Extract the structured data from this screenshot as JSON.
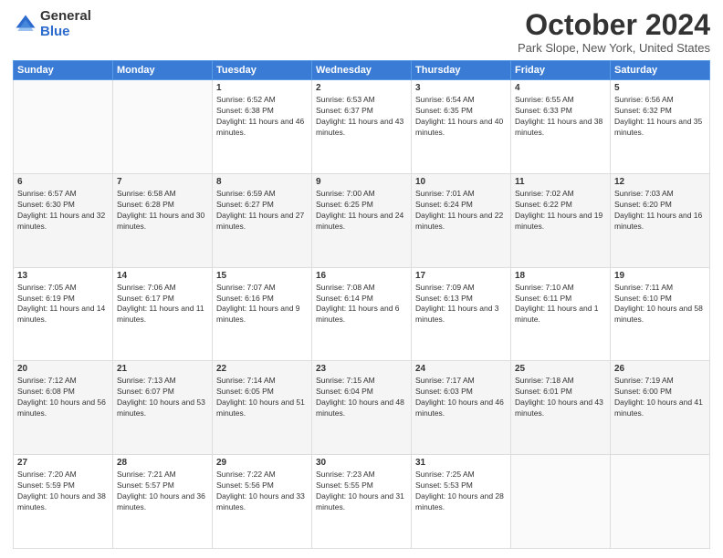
{
  "logo": {
    "general": "General",
    "blue": "Blue"
  },
  "title": {
    "month": "October 2024",
    "location": "Park Slope, New York, United States"
  },
  "days_header": [
    "Sunday",
    "Monday",
    "Tuesday",
    "Wednesday",
    "Thursday",
    "Friday",
    "Saturday"
  ],
  "weeks": [
    [
      {
        "day": "",
        "info": ""
      },
      {
        "day": "",
        "info": ""
      },
      {
        "day": "1",
        "info": "Sunrise: 6:52 AM\nSunset: 6:38 PM\nDaylight: 11 hours and 46 minutes."
      },
      {
        "day": "2",
        "info": "Sunrise: 6:53 AM\nSunset: 6:37 PM\nDaylight: 11 hours and 43 minutes."
      },
      {
        "day": "3",
        "info": "Sunrise: 6:54 AM\nSunset: 6:35 PM\nDaylight: 11 hours and 40 minutes."
      },
      {
        "day": "4",
        "info": "Sunrise: 6:55 AM\nSunset: 6:33 PM\nDaylight: 11 hours and 38 minutes."
      },
      {
        "day": "5",
        "info": "Sunrise: 6:56 AM\nSunset: 6:32 PM\nDaylight: 11 hours and 35 minutes."
      }
    ],
    [
      {
        "day": "6",
        "info": "Sunrise: 6:57 AM\nSunset: 6:30 PM\nDaylight: 11 hours and 32 minutes."
      },
      {
        "day": "7",
        "info": "Sunrise: 6:58 AM\nSunset: 6:28 PM\nDaylight: 11 hours and 30 minutes."
      },
      {
        "day": "8",
        "info": "Sunrise: 6:59 AM\nSunset: 6:27 PM\nDaylight: 11 hours and 27 minutes."
      },
      {
        "day": "9",
        "info": "Sunrise: 7:00 AM\nSunset: 6:25 PM\nDaylight: 11 hours and 24 minutes."
      },
      {
        "day": "10",
        "info": "Sunrise: 7:01 AM\nSunset: 6:24 PM\nDaylight: 11 hours and 22 minutes."
      },
      {
        "day": "11",
        "info": "Sunrise: 7:02 AM\nSunset: 6:22 PM\nDaylight: 11 hours and 19 minutes."
      },
      {
        "day": "12",
        "info": "Sunrise: 7:03 AM\nSunset: 6:20 PM\nDaylight: 11 hours and 16 minutes."
      }
    ],
    [
      {
        "day": "13",
        "info": "Sunrise: 7:05 AM\nSunset: 6:19 PM\nDaylight: 11 hours and 14 minutes."
      },
      {
        "day": "14",
        "info": "Sunrise: 7:06 AM\nSunset: 6:17 PM\nDaylight: 11 hours and 11 minutes."
      },
      {
        "day": "15",
        "info": "Sunrise: 7:07 AM\nSunset: 6:16 PM\nDaylight: 11 hours and 9 minutes."
      },
      {
        "day": "16",
        "info": "Sunrise: 7:08 AM\nSunset: 6:14 PM\nDaylight: 11 hours and 6 minutes."
      },
      {
        "day": "17",
        "info": "Sunrise: 7:09 AM\nSunset: 6:13 PM\nDaylight: 11 hours and 3 minutes."
      },
      {
        "day": "18",
        "info": "Sunrise: 7:10 AM\nSunset: 6:11 PM\nDaylight: 11 hours and 1 minute."
      },
      {
        "day": "19",
        "info": "Sunrise: 7:11 AM\nSunset: 6:10 PM\nDaylight: 10 hours and 58 minutes."
      }
    ],
    [
      {
        "day": "20",
        "info": "Sunrise: 7:12 AM\nSunset: 6:08 PM\nDaylight: 10 hours and 56 minutes."
      },
      {
        "day": "21",
        "info": "Sunrise: 7:13 AM\nSunset: 6:07 PM\nDaylight: 10 hours and 53 minutes."
      },
      {
        "day": "22",
        "info": "Sunrise: 7:14 AM\nSunset: 6:05 PM\nDaylight: 10 hours and 51 minutes."
      },
      {
        "day": "23",
        "info": "Sunrise: 7:15 AM\nSunset: 6:04 PM\nDaylight: 10 hours and 48 minutes."
      },
      {
        "day": "24",
        "info": "Sunrise: 7:17 AM\nSunset: 6:03 PM\nDaylight: 10 hours and 46 minutes."
      },
      {
        "day": "25",
        "info": "Sunrise: 7:18 AM\nSunset: 6:01 PM\nDaylight: 10 hours and 43 minutes."
      },
      {
        "day": "26",
        "info": "Sunrise: 7:19 AM\nSunset: 6:00 PM\nDaylight: 10 hours and 41 minutes."
      }
    ],
    [
      {
        "day": "27",
        "info": "Sunrise: 7:20 AM\nSunset: 5:59 PM\nDaylight: 10 hours and 38 minutes."
      },
      {
        "day": "28",
        "info": "Sunrise: 7:21 AM\nSunset: 5:57 PM\nDaylight: 10 hours and 36 minutes."
      },
      {
        "day": "29",
        "info": "Sunrise: 7:22 AM\nSunset: 5:56 PM\nDaylight: 10 hours and 33 minutes."
      },
      {
        "day": "30",
        "info": "Sunrise: 7:23 AM\nSunset: 5:55 PM\nDaylight: 10 hours and 31 minutes."
      },
      {
        "day": "31",
        "info": "Sunrise: 7:25 AM\nSunset: 5:53 PM\nDaylight: 10 hours and 28 minutes."
      },
      {
        "day": "",
        "info": ""
      },
      {
        "day": "",
        "info": ""
      }
    ]
  ]
}
